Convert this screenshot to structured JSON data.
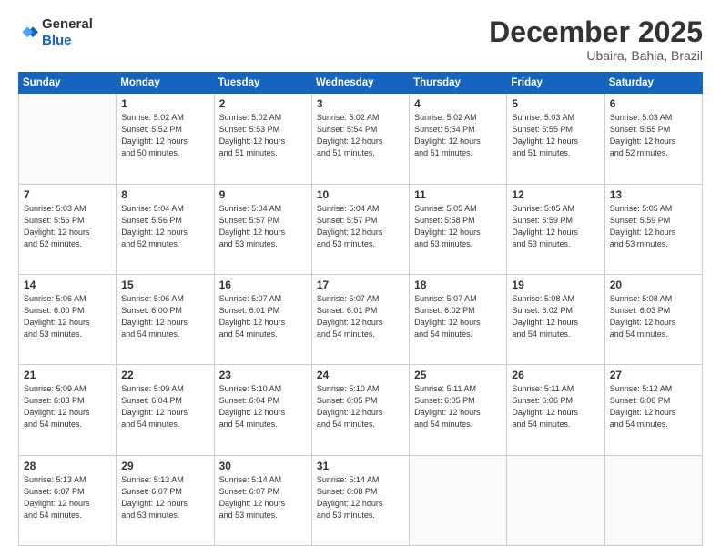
{
  "header": {
    "logo_general": "General",
    "logo_blue": "Blue",
    "month_title": "December 2025",
    "location": "Ubaira, Bahia, Brazil"
  },
  "days_of_week": [
    "Sunday",
    "Monday",
    "Tuesday",
    "Wednesday",
    "Thursday",
    "Friday",
    "Saturday"
  ],
  "weeks": [
    [
      {
        "day": "",
        "info": ""
      },
      {
        "day": "1",
        "info": "Sunrise: 5:02 AM\nSunset: 5:52 PM\nDaylight: 12 hours\nand 50 minutes."
      },
      {
        "day": "2",
        "info": "Sunrise: 5:02 AM\nSunset: 5:53 PM\nDaylight: 12 hours\nand 51 minutes."
      },
      {
        "day": "3",
        "info": "Sunrise: 5:02 AM\nSunset: 5:54 PM\nDaylight: 12 hours\nand 51 minutes."
      },
      {
        "day": "4",
        "info": "Sunrise: 5:02 AM\nSunset: 5:54 PM\nDaylight: 12 hours\nand 51 minutes."
      },
      {
        "day": "5",
        "info": "Sunrise: 5:03 AM\nSunset: 5:55 PM\nDaylight: 12 hours\nand 51 minutes."
      },
      {
        "day": "6",
        "info": "Sunrise: 5:03 AM\nSunset: 5:55 PM\nDaylight: 12 hours\nand 52 minutes."
      }
    ],
    [
      {
        "day": "7",
        "info": "Sunrise: 5:03 AM\nSunset: 5:56 PM\nDaylight: 12 hours\nand 52 minutes."
      },
      {
        "day": "8",
        "info": "Sunrise: 5:04 AM\nSunset: 5:56 PM\nDaylight: 12 hours\nand 52 minutes."
      },
      {
        "day": "9",
        "info": "Sunrise: 5:04 AM\nSunset: 5:57 PM\nDaylight: 12 hours\nand 53 minutes."
      },
      {
        "day": "10",
        "info": "Sunrise: 5:04 AM\nSunset: 5:57 PM\nDaylight: 12 hours\nand 53 minutes."
      },
      {
        "day": "11",
        "info": "Sunrise: 5:05 AM\nSunset: 5:58 PM\nDaylight: 12 hours\nand 53 minutes."
      },
      {
        "day": "12",
        "info": "Sunrise: 5:05 AM\nSunset: 5:59 PM\nDaylight: 12 hours\nand 53 minutes."
      },
      {
        "day": "13",
        "info": "Sunrise: 5:05 AM\nSunset: 5:59 PM\nDaylight: 12 hours\nand 53 minutes."
      }
    ],
    [
      {
        "day": "14",
        "info": "Sunrise: 5:06 AM\nSunset: 6:00 PM\nDaylight: 12 hours\nand 53 minutes."
      },
      {
        "day": "15",
        "info": "Sunrise: 5:06 AM\nSunset: 6:00 PM\nDaylight: 12 hours\nand 54 minutes."
      },
      {
        "day": "16",
        "info": "Sunrise: 5:07 AM\nSunset: 6:01 PM\nDaylight: 12 hours\nand 54 minutes."
      },
      {
        "day": "17",
        "info": "Sunrise: 5:07 AM\nSunset: 6:01 PM\nDaylight: 12 hours\nand 54 minutes."
      },
      {
        "day": "18",
        "info": "Sunrise: 5:07 AM\nSunset: 6:02 PM\nDaylight: 12 hours\nand 54 minutes."
      },
      {
        "day": "19",
        "info": "Sunrise: 5:08 AM\nSunset: 6:02 PM\nDaylight: 12 hours\nand 54 minutes."
      },
      {
        "day": "20",
        "info": "Sunrise: 5:08 AM\nSunset: 6:03 PM\nDaylight: 12 hours\nand 54 minutes."
      }
    ],
    [
      {
        "day": "21",
        "info": "Sunrise: 5:09 AM\nSunset: 6:03 PM\nDaylight: 12 hours\nand 54 minutes."
      },
      {
        "day": "22",
        "info": "Sunrise: 5:09 AM\nSunset: 6:04 PM\nDaylight: 12 hours\nand 54 minutes."
      },
      {
        "day": "23",
        "info": "Sunrise: 5:10 AM\nSunset: 6:04 PM\nDaylight: 12 hours\nand 54 minutes."
      },
      {
        "day": "24",
        "info": "Sunrise: 5:10 AM\nSunset: 6:05 PM\nDaylight: 12 hours\nand 54 minutes."
      },
      {
        "day": "25",
        "info": "Sunrise: 5:11 AM\nSunset: 6:05 PM\nDaylight: 12 hours\nand 54 minutes."
      },
      {
        "day": "26",
        "info": "Sunrise: 5:11 AM\nSunset: 6:06 PM\nDaylight: 12 hours\nand 54 minutes."
      },
      {
        "day": "27",
        "info": "Sunrise: 5:12 AM\nSunset: 6:06 PM\nDaylight: 12 hours\nand 54 minutes."
      }
    ],
    [
      {
        "day": "28",
        "info": "Sunrise: 5:13 AM\nSunset: 6:07 PM\nDaylight: 12 hours\nand 54 minutes."
      },
      {
        "day": "29",
        "info": "Sunrise: 5:13 AM\nSunset: 6:07 PM\nDaylight: 12 hours\nand 53 minutes."
      },
      {
        "day": "30",
        "info": "Sunrise: 5:14 AM\nSunset: 6:07 PM\nDaylight: 12 hours\nand 53 minutes."
      },
      {
        "day": "31",
        "info": "Sunrise: 5:14 AM\nSunset: 6:08 PM\nDaylight: 12 hours\nand 53 minutes."
      },
      {
        "day": "",
        "info": ""
      },
      {
        "day": "",
        "info": ""
      },
      {
        "day": "",
        "info": ""
      }
    ]
  ]
}
